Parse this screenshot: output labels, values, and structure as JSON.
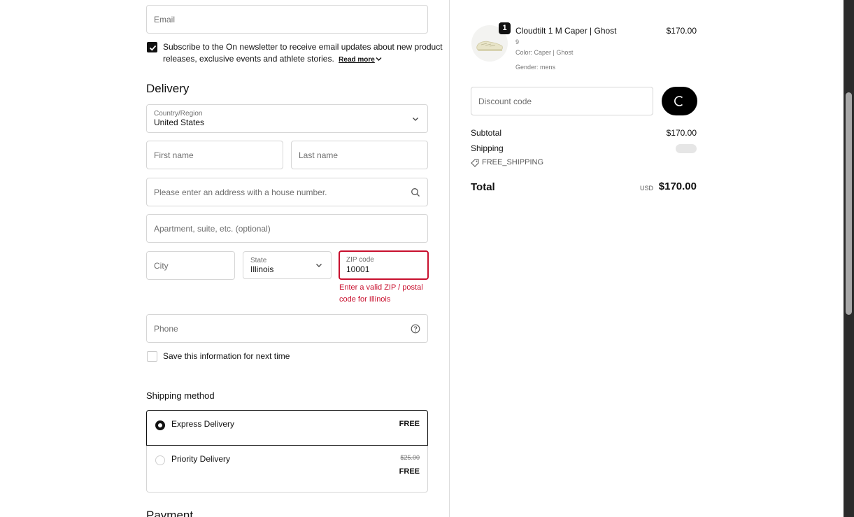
{
  "contact": {
    "email_placeholder": "Email",
    "newsletter_text_line1": "Subscribe to the On newsletter to receive email updates about new product",
    "newsletter_text_line2": "releases, exclusive events and athlete stories.",
    "read_more_label": "Read more",
    "newsletter_checked": true
  },
  "delivery": {
    "heading": "Delivery",
    "country_label": "Country/Region",
    "country_value": "United States",
    "first_name_placeholder": "First name",
    "last_name_placeholder": "Last name",
    "address_placeholder": "Please enter an address with a house number.",
    "apartment_placeholder": "Apartment, suite, etc. (optional)",
    "city_placeholder": "City",
    "state_label": "State",
    "state_value": "Illinois",
    "zip_label": "ZIP code",
    "zip_value": "10001",
    "zip_error_line1": "Enter a valid ZIP / postal",
    "zip_error_line2": "code for Illinois",
    "phone_placeholder": "Phone",
    "save_info_label": "Save this information for next time"
  },
  "shipping": {
    "heading": "Shipping method",
    "options": [
      {
        "label": "Express Delivery",
        "price": "FREE",
        "selected": true
      },
      {
        "label": "Priority Delivery",
        "original_price": "$25.00",
        "price": "FREE",
        "selected": false
      }
    ]
  },
  "payment": {
    "heading": "Payment"
  },
  "summary": {
    "item": {
      "quantity_badge": "1",
      "name": "Cloudtilt 1 M Caper | Ghost",
      "size": "9",
      "color": "Color: Caper | Ghost",
      "gender": "Gender: mens",
      "price": "$170.00"
    },
    "discount_placeholder": "Discount code",
    "subtotal_label": "Subtotal",
    "subtotal_value": "$170.00",
    "shipping_label": "Shipping",
    "promo_code": "FREE_SHIPPING",
    "total_label": "Total",
    "currency": "USD",
    "total_value": "$170.00"
  },
  "colors": {
    "accent": "#111111",
    "error": "#c8102e",
    "border": "#d6d6d6"
  }
}
